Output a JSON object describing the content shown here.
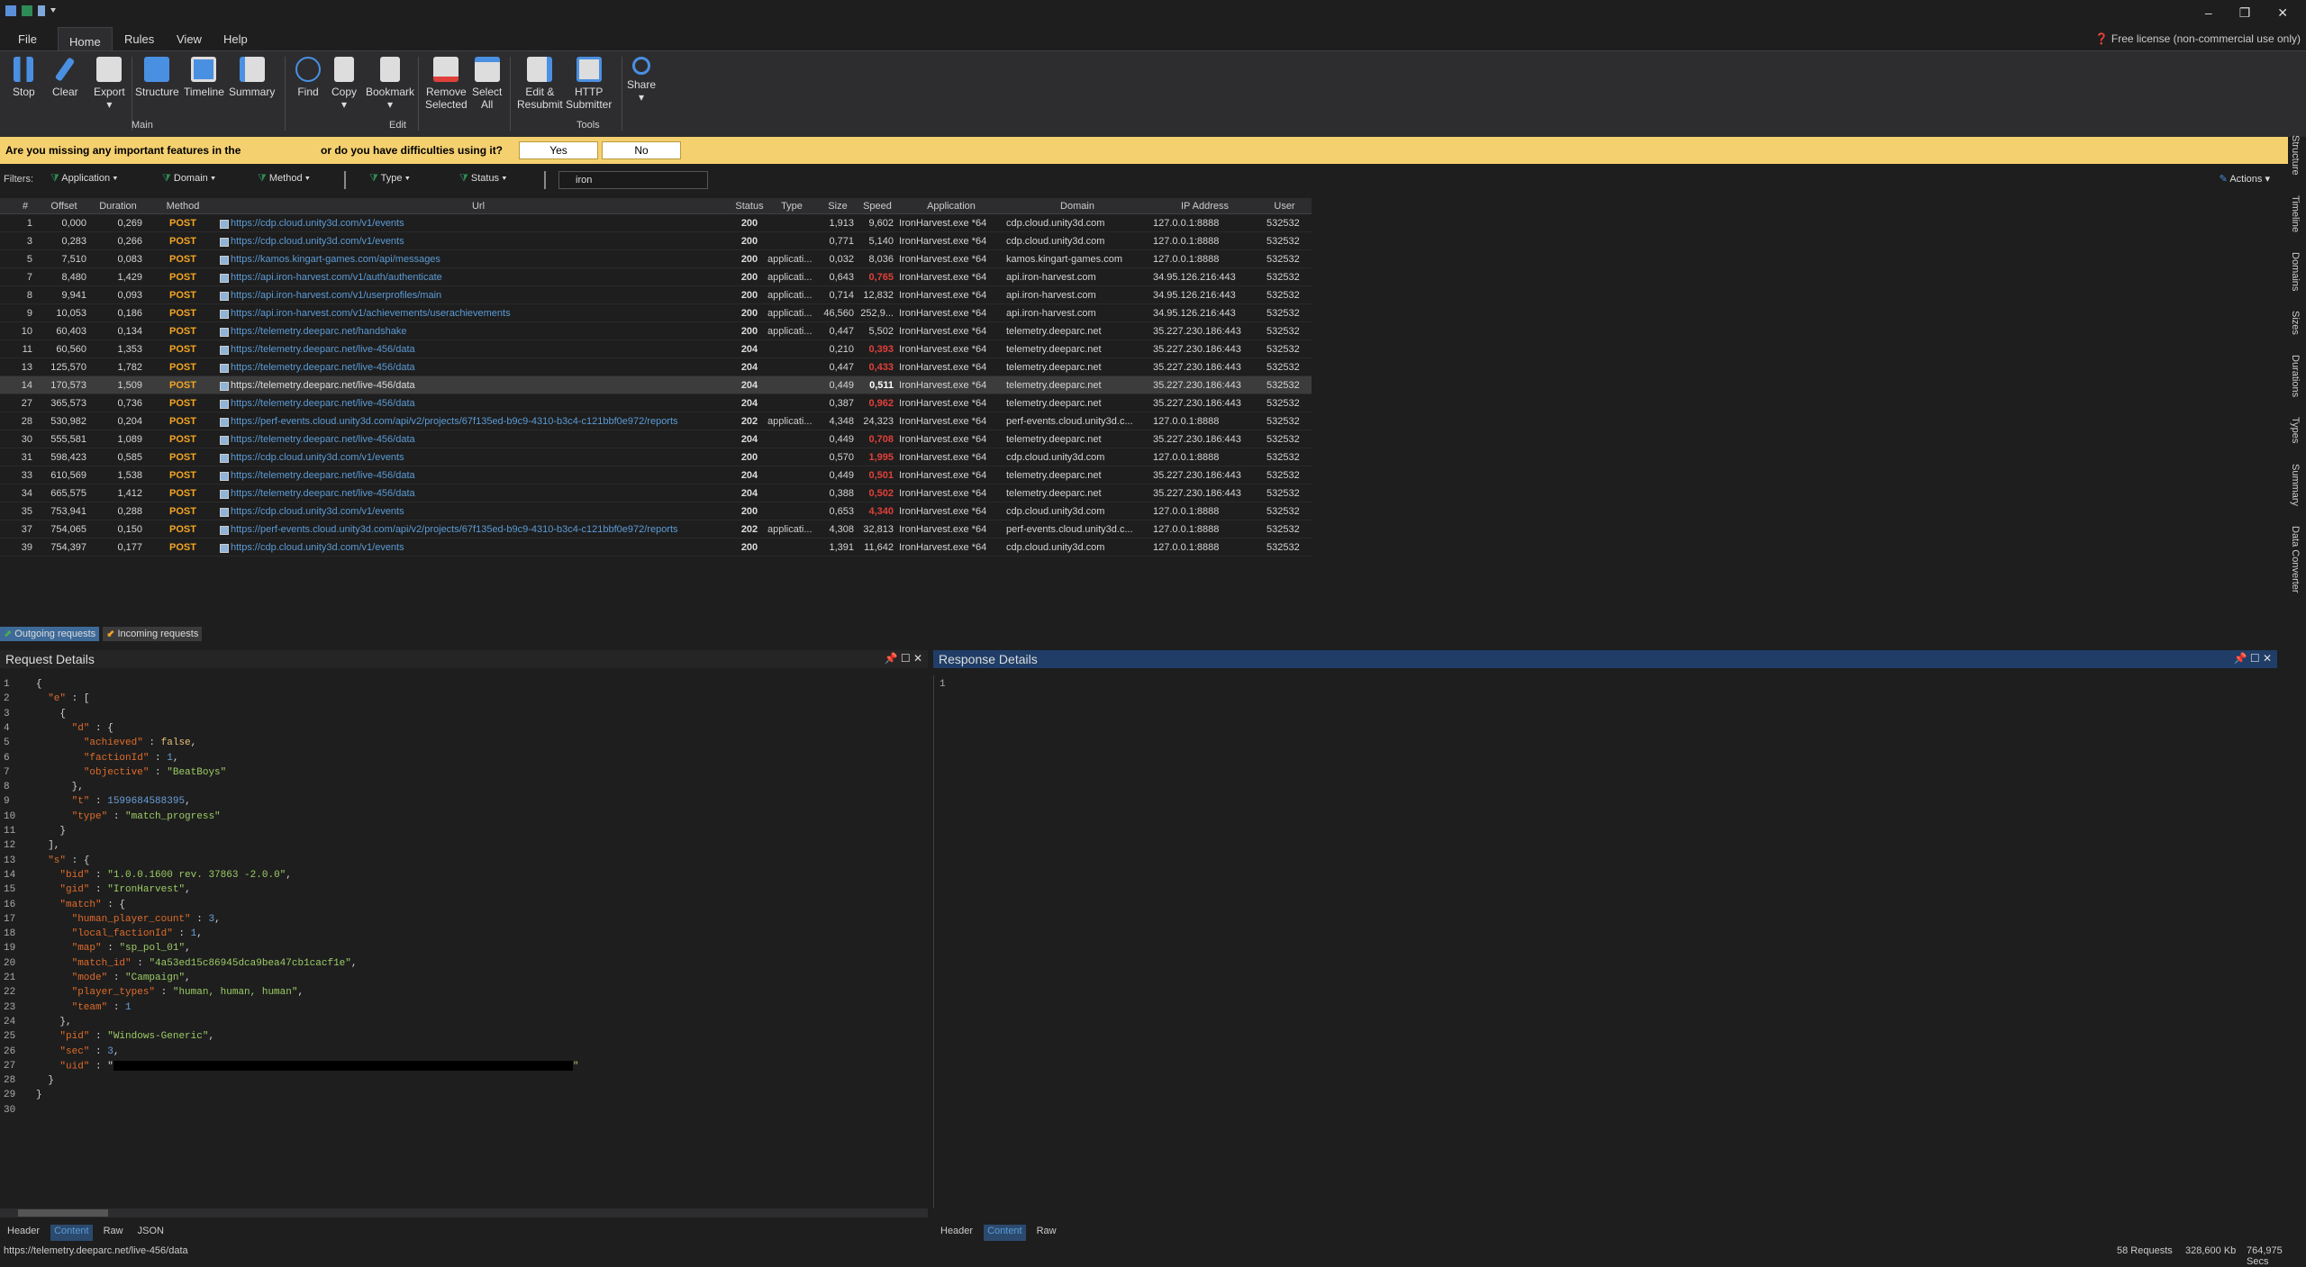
{
  "menu": {
    "file": "File",
    "home": "Home",
    "rules": "Rules",
    "view": "View",
    "help": "Help"
  },
  "license": "Free license (non-commercial use only)",
  "ribbon": {
    "stop": "Stop",
    "clear": "Clear",
    "export": "Export",
    "structure": "Structure",
    "timeline": "Timeline",
    "summary": "Summary",
    "find": "Find",
    "copy": "Copy",
    "bookmark": "Bookmark",
    "remove_selected_1": "Remove",
    "remove_selected_2": "Selected",
    "select_all_1": "Select",
    "select_all_2": "All",
    "edit_resubmit_1": "Edit &",
    "edit_resubmit_2": "Resubmit",
    "http_submitter_1": "HTTP",
    "http_submitter_2": "Submitter",
    "share": "Share",
    "group_main": "Main",
    "group_edit": "Edit",
    "group_tools": "Tools"
  },
  "banner": {
    "text1": "Are you missing any important features in the",
    "text2": "or do you have difficulties using it?",
    "yes": "Yes",
    "no": "No"
  },
  "filters": {
    "label": "Filters:",
    "application": "Application",
    "domain": "Domain",
    "method": "Method",
    "type": "Type",
    "status": "Status",
    "search": "iron",
    "actions": "Actions"
  },
  "columns": {
    "num": "#",
    "offset": "Offset",
    "duration": "Duration",
    "method": "Method",
    "url": "Url",
    "status": "Status",
    "type": "Type",
    "size": "Size",
    "speed": "Speed",
    "application": "Application",
    "domain": "Domain",
    "ip": "IP Address",
    "user": "User"
  },
  "rows": [
    {
      "num": "1",
      "offset": "0,000",
      "duration": "0,269",
      "method": "POST",
      "url": "https://cdp.cloud.unity3d.com/v1/events",
      "status": "200",
      "type": "",
      "size": "1,913",
      "speed": "9,602",
      "speed_style": "",
      "app": "IronHarvest.exe *64",
      "domain": "cdp.cloud.unity3d.com",
      "ip": "127.0.0.1:8888",
      "user": "532532"
    },
    {
      "num": "3",
      "offset": "0,283",
      "duration": "0,266",
      "method": "POST",
      "url": "https://cdp.cloud.unity3d.com/v1/events",
      "status": "200",
      "type": "",
      "size": "0,771",
      "speed": "5,140",
      "speed_style": "",
      "app": "IronHarvest.exe *64",
      "domain": "cdp.cloud.unity3d.com",
      "ip": "127.0.0.1:8888",
      "user": "532532"
    },
    {
      "num": "5",
      "offset": "7,510",
      "duration": "0,083",
      "method": "POST",
      "url": "https://kamos.kingart-games.com/api/messages",
      "status": "200",
      "type": "applicati...",
      "size": "0,032",
      "speed": "8,036",
      "speed_style": "",
      "app": "IronHarvest.exe *64",
      "domain": "kamos.kingart-games.com",
      "ip": "127.0.0.1:8888",
      "user": "532532"
    },
    {
      "num": "7",
      "offset": "8,480",
      "duration": "1,429",
      "method": "POST",
      "url": "https://api.iron-harvest.com/v1/auth/authenticate",
      "status": "200",
      "type": "applicati...",
      "size": "0,643",
      "speed": "0,765",
      "speed_style": "red",
      "app": "IronHarvest.exe *64",
      "domain": "api.iron-harvest.com",
      "ip": "34.95.126.216:443",
      "user": "532532"
    },
    {
      "num": "8",
      "offset": "9,941",
      "duration": "0,093",
      "method": "POST",
      "url": "https://api.iron-harvest.com/v1/userprofiles/main",
      "status": "200",
      "type": "applicati...",
      "size": "0,714",
      "speed": "12,832",
      "speed_style": "",
      "app": "IronHarvest.exe *64",
      "domain": "api.iron-harvest.com",
      "ip": "34.95.126.216:443",
      "user": "532532"
    },
    {
      "num": "9",
      "offset": "10,053",
      "duration": "0,186",
      "method": "POST",
      "url": "https://api.iron-harvest.com/v1/achievements/userachievements",
      "status": "200",
      "type": "applicati...",
      "size": "46,560",
      "speed": "252,9...",
      "speed_style": "",
      "app": "IronHarvest.exe *64",
      "domain": "api.iron-harvest.com",
      "ip": "34.95.126.216:443",
      "user": "532532"
    },
    {
      "num": "10",
      "offset": "60,403",
      "duration": "0,134",
      "method": "POST",
      "url": "https://telemetry.deeparc.net/handshake",
      "status": "200",
      "type": "applicati...",
      "size": "0,447",
      "speed": "5,502",
      "speed_style": "",
      "app": "IronHarvest.exe *64",
      "domain": "telemetry.deeparc.net",
      "ip": "35.227.230.186:443",
      "user": "532532"
    },
    {
      "num": "11",
      "offset": "60,560",
      "duration": "1,353",
      "method": "POST",
      "url": "https://telemetry.deeparc.net/live-456/data",
      "status": "204",
      "type": "",
      "size": "0,210",
      "speed": "0,393",
      "speed_style": "red",
      "app": "IronHarvest.exe *64",
      "domain": "telemetry.deeparc.net",
      "ip": "35.227.230.186:443",
      "user": "532532"
    },
    {
      "num": "13",
      "offset": "125,570",
      "duration": "1,782",
      "method": "POST",
      "url": "https://telemetry.deeparc.net/live-456/data",
      "status": "204",
      "type": "",
      "size": "0,447",
      "speed": "0,433",
      "speed_style": "red",
      "app": "IronHarvest.exe *64",
      "domain": "telemetry.deeparc.net",
      "ip": "35.227.230.186:443",
      "user": "532532"
    },
    {
      "num": "14",
      "offset": "170,573",
      "duration": "1,509",
      "method": "POST",
      "url": "https://telemetry.deeparc.net/live-456/data",
      "status": "204",
      "type": "",
      "size": "0,449",
      "speed": "0,511",
      "speed_style": "w",
      "app": "IronHarvest.exe *64",
      "domain": "telemetry.deeparc.net",
      "ip": "35.227.230.186:443",
      "user": "532532",
      "selected": true
    },
    {
      "num": "27",
      "offset": "365,573",
      "duration": "0,736",
      "method": "POST",
      "url": "https://telemetry.deeparc.net/live-456/data",
      "status": "204",
      "type": "",
      "size": "0,387",
      "speed": "0,962",
      "speed_style": "red",
      "app": "IronHarvest.exe *64",
      "domain": "telemetry.deeparc.net",
      "ip": "35.227.230.186:443",
      "user": "532532"
    },
    {
      "num": "28",
      "offset": "530,982",
      "duration": "0,204",
      "method": "POST",
      "url": "https://perf-events.cloud.unity3d.com/api/v2/projects/67f135ed-b9c9-4310-b3c4-c121bbf0e972/reports",
      "status": "202",
      "type": "applicati...",
      "size": "4,348",
      "speed": "24,323",
      "speed_style": "",
      "app": "IronHarvest.exe *64",
      "domain": "perf-events.cloud.unity3d.c...",
      "ip": "127.0.0.1:8888",
      "user": "532532"
    },
    {
      "num": "30",
      "offset": "555,581",
      "duration": "1,089",
      "method": "POST",
      "url": "https://telemetry.deeparc.net/live-456/data",
      "status": "204",
      "type": "",
      "size": "0,449",
      "speed": "0,708",
      "speed_style": "red",
      "app": "IronHarvest.exe *64",
      "domain": "telemetry.deeparc.net",
      "ip": "35.227.230.186:443",
      "user": "532532"
    },
    {
      "num": "31",
      "offset": "598,423",
      "duration": "0,585",
      "method": "POST",
      "url": "https://cdp.cloud.unity3d.com/v1/events",
      "status": "200",
      "type": "",
      "size": "0,570",
      "speed": "1,995",
      "speed_style": "red",
      "app": "IronHarvest.exe *64",
      "domain": "cdp.cloud.unity3d.com",
      "ip": "127.0.0.1:8888",
      "user": "532532"
    },
    {
      "num": "33",
      "offset": "610,569",
      "duration": "1,538",
      "method": "POST",
      "url": "https://telemetry.deeparc.net/live-456/data",
      "status": "204",
      "type": "",
      "size": "0,449",
      "speed": "0,501",
      "speed_style": "red",
      "app": "IronHarvest.exe *64",
      "domain": "telemetry.deeparc.net",
      "ip": "35.227.230.186:443",
      "user": "532532"
    },
    {
      "num": "34",
      "offset": "665,575",
      "duration": "1,412",
      "method": "POST",
      "url": "https://telemetry.deeparc.net/live-456/data",
      "status": "204",
      "type": "",
      "size": "0,388",
      "speed": "0,502",
      "speed_style": "red",
      "app": "IronHarvest.exe *64",
      "domain": "telemetry.deeparc.net",
      "ip": "35.227.230.186:443",
      "user": "532532"
    },
    {
      "num": "35",
      "offset": "753,941",
      "duration": "0,288",
      "method": "POST",
      "url": "https://cdp.cloud.unity3d.com/v1/events",
      "status": "200",
      "type": "",
      "size": "0,653",
      "speed": "4,340",
      "speed_style": "red",
      "app": "IronHarvest.exe *64",
      "domain": "cdp.cloud.unity3d.com",
      "ip": "127.0.0.1:8888",
      "user": "532532"
    },
    {
      "num": "37",
      "offset": "754,065",
      "duration": "0,150",
      "method": "POST",
      "url": "https://perf-events.cloud.unity3d.com/api/v2/projects/67f135ed-b9c9-4310-b3c4-c121bbf0e972/reports",
      "status": "202",
      "type": "applicati...",
      "size": "4,308",
      "speed": "32,813",
      "speed_style": "",
      "app": "IronHarvest.exe *64",
      "domain": "perf-events.cloud.unity3d.c...",
      "ip": "127.0.0.1:8888",
      "user": "532532"
    },
    {
      "num": "39",
      "offset": "754,397",
      "duration": "0,177",
      "method": "POST",
      "url": "https://cdp.cloud.unity3d.com/v1/events",
      "status": "200",
      "type": "",
      "size": "1,391",
      "speed": "11,642",
      "speed_style": "",
      "app": "IronHarvest.exe *64",
      "domain": "cdp.cloud.unity3d.com",
      "ip": "127.0.0.1:8888",
      "user": "532532"
    }
  ],
  "sidetabs": [
    "Structure",
    "Timeline",
    "Domains",
    "Sizes",
    "Durations",
    "Types",
    "Summary",
    "Data Converter"
  ],
  "req_tabs": {
    "outgoing": "Outgoing requests",
    "incoming": "Incoming requests"
  },
  "request_details": "Request Details",
  "response_details": "Response Details",
  "code_lines": [
    "{",
    "  \"e\" : [",
    "    {",
    "      \"d\" : {",
    "        \"achieved\" : false,",
    "        \"factionId\" : 1,",
    "        \"objective\" : \"BeatBoys\"",
    "      },",
    "      \"t\" : 1599684588395,",
    "      \"type\" : \"match_progress\"",
    "    }",
    "  ],",
    "  \"s\" : {",
    "    \"bid\" : \"1.0.0.1600 rev. 37863 -2.0.0\",",
    "    \"gid\" : \"IronHarvest\",",
    "    \"match\" : {",
    "      \"human_player_count\" : 3,",
    "      \"local_factionId\" : 1,",
    "      \"map\" : \"sp_pol_01\",",
    "      \"match_id\" : \"4a53ed15c86945dca9bea47cb1cacf1e\",",
    "      \"mode\" : \"Campaign\",",
    "      \"player_types\" : \"human, human, human\",",
    "      \"team\" : 1",
    "    },",
    "    \"pid\" : \"Windows-Generic\",",
    "    \"sec\" : 3,",
    "    \"uid\" : \"",
    "  }",
    "}",
    ""
  ],
  "bottom_tabs_left": {
    "header": "Header",
    "content": "Content",
    "raw": "Raw",
    "json": "JSON"
  },
  "bottom_tabs_right": {
    "header": "Header",
    "content": "Content",
    "raw": "Raw"
  },
  "status": {
    "url": "https://telemetry.deeparc.net/live-456/data",
    "requests": "58 Requests",
    "kb": "328,600 Kb",
    "total": "764,975 Secs"
  }
}
